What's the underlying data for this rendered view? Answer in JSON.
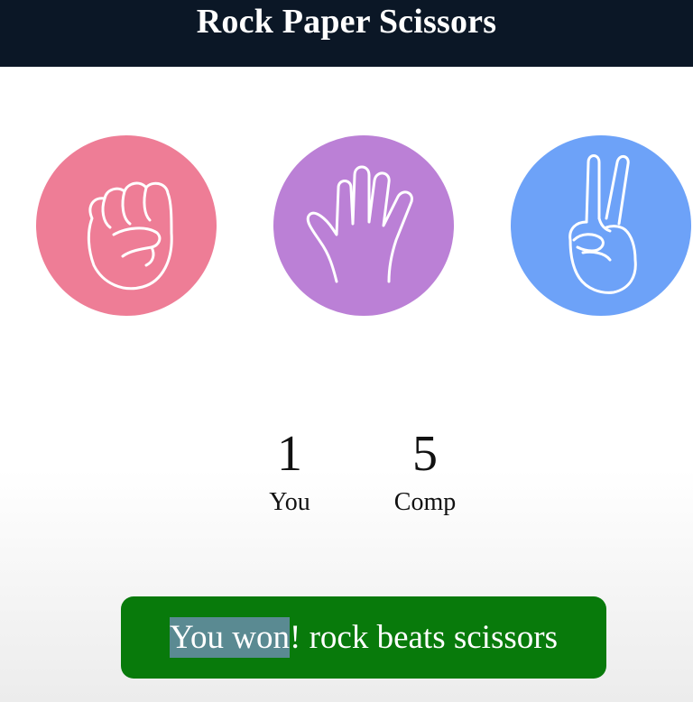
{
  "header": {
    "title": "Rock Paper Scissors"
  },
  "choices": [
    {
      "name": "rock",
      "icon": "fist-icon",
      "color": "#ee7d96"
    },
    {
      "name": "paper",
      "icon": "open-hand-icon",
      "color": "#bb80d6"
    },
    {
      "name": "scissors",
      "icon": "peace-sign-icon",
      "color": "#6da2f8"
    }
  ],
  "scores": {
    "you": {
      "value": "1",
      "label": "You"
    },
    "comp": {
      "value": "5",
      "label": "Comp"
    }
  },
  "result": {
    "highlighted_text": "You won",
    "text": "! rock beats scissors",
    "background_color": "#087a0b",
    "highlight_color": "#5a8a92"
  }
}
